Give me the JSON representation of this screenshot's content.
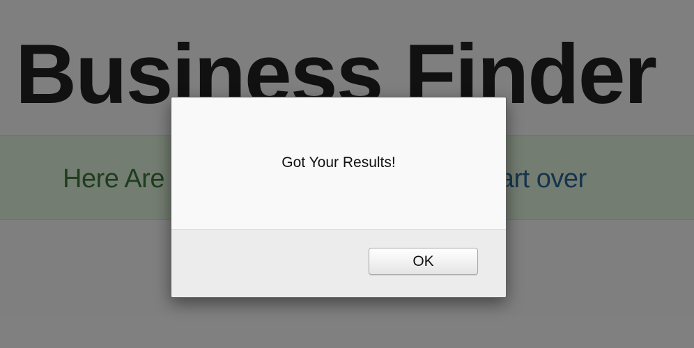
{
  "page": {
    "title": "Business Finder",
    "banner": {
      "text_before_link": "Here Are Your Results! Click here to ",
      "link_text": "start over"
    }
  },
  "alert": {
    "message": "Got Your Results!",
    "ok_label": "OK"
  },
  "colors": {
    "banner_background": "#dff0d8",
    "banner_text": "#3c763d",
    "link": "#2a6496",
    "title": "#222222",
    "overlay": "rgba(0,0,0,0.48)"
  }
}
